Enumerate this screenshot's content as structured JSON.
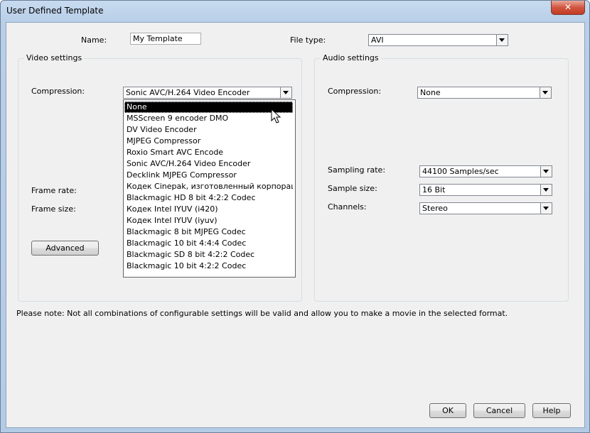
{
  "window": {
    "title": "User Defined Template",
    "close_glyph": "✕"
  },
  "name_field": {
    "label": "Name:",
    "value": "My Template"
  },
  "file_type": {
    "label": "File type:",
    "value": "AVI"
  },
  "video_settings": {
    "title": "Video settings",
    "compression_label": "Compression:",
    "compression_value": "Sonic AVC/H.264 Video Encoder",
    "frame_rate_label": "Frame rate:",
    "frame_size_label": "Frame size:",
    "advanced_button": "Advanced",
    "dropdown_items": [
      "None",
      "MSScreen 9 encoder DMO",
      "DV Video Encoder",
      "MJPEG Compressor",
      "Roxio Smart AVC Encode",
      "Sonic AVC/H.264 Video Encoder",
      "Decklink MJPEG Compressor",
      "Кодек Cinepak, изготовленный корпорацией R",
      "Blackmagic HD 8 bit 4:2:2 Codec",
      "Кодек Intel IYUV (i420)",
      "Кодек Intel IYUV (iyuv)",
      "Blackmagic 8 bit MJPEG Codec",
      "Blackmagic 10 bit 4:4:4 Codec",
      "Blackmagic SD 8 bit 4:2:2 Codec",
      "Blackmagic 10 bit 4:2:2 Codec"
    ],
    "dropdown_selected_index": 0
  },
  "audio_settings": {
    "title": "Audio settings",
    "compression_label": "Compression:",
    "compression_value": "None",
    "sampling_rate_label": "Sampling rate:",
    "sampling_rate_value": "44100 Samples/sec",
    "sample_size_label": "Sample size:",
    "sample_size_value": "16 Bit",
    "channels_label": "Channels:",
    "channels_value": "Stereo"
  },
  "note": "Please note: Not all combinations of configurable settings will be valid and allow you to make a movie in the selected format.",
  "buttons": {
    "ok": "OK",
    "cancel": "Cancel",
    "help": "Help"
  }
}
